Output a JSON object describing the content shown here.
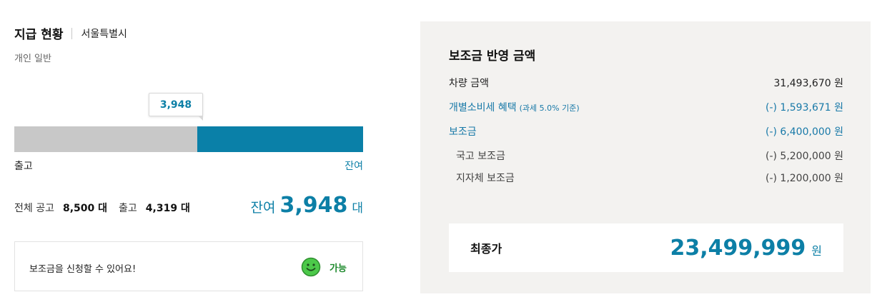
{
  "status_panel": {
    "title": "지급 현황",
    "region": "서울특별시",
    "category": "개인 일반",
    "tooltip_value": "3,948",
    "bar": {
      "released_fraction": 0.5247,
      "remaining_fraction": 0.4753
    },
    "bar_label_released": "출고",
    "bar_label_remaining": "잔여",
    "total_label": "전체 공고",
    "total_value": "8,500 대",
    "released_label": "출고",
    "released_value": "4,319 대",
    "remaining_label": "잔여",
    "remaining_value": "3,948",
    "remaining_unit": "대",
    "notice_text": "보조금을 신청할 수 있어요!",
    "notice_status": "가능",
    "notice_icon": "smile-icon",
    "colors": {
      "accent": "#0a80a8",
      "used": "#c8c8c8",
      "ok": "#1e8a2d",
      "smile": "#4cc94a"
    }
  },
  "subsidy_panel": {
    "title": "보조금 반영 금액",
    "rows": [
      {
        "label": "차량 금액",
        "note": "",
        "value": "31,493,670 원",
        "style": "normal"
      },
      {
        "label": "개별소비세 혜택",
        "note": "(과세 5.0% 기준)",
        "value": "(-) 1,593,671 원",
        "style": "blue"
      },
      {
        "label": "보조금",
        "note": "",
        "value": "(-) 6,400,000 원",
        "style": "blue"
      },
      {
        "label": "국고 보조금",
        "note": "",
        "value": "(-) 5,200,000 원",
        "style": "sub"
      },
      {
        "label": "지자체 보조금",
        "note": "",
        "value": "(-) 1,200,000 원",
        "style": "sub"
      }
    ],
    "final_label": "최종가",
    "final_value": "23,499,999",
    "final_unit": "원"
  }
}
